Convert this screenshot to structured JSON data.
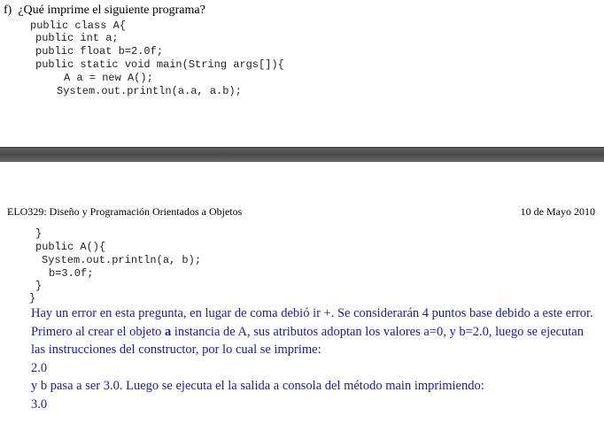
{
  "question": {
    "label": "f)",
    "text": "¿Qué imprime el siguiente programa?"
  },
  "code_top": [
    "public class A{",
    "public int a;",
    "public float b=2.0f;",
    "public static void main(String args[]){",
    "A a = new A();",
    "System.out.println(a.a, a.b);"
  ],
  "header": {
    "course": "ELO329: Diseño y Programación Orientados a Objetos",
    "date": "10 de Mayo 2010"
  },
  "code_bottom": [
    "}",
    "public A(){",
    "System.out.println(a, b);",
    "b=3.0f;",
    "}",
    "}"
  ],
  "answer": {
    "line1": "Hay un error en esta pregunta, en lugar de coma debió ir +. Se considerarán 4 puntos base debido a este error.",
    "line2_before": "Primero al crear el objeto ",
    "line2_bold": "a",
    "line2_after": " instancia de A, sus atributos adoptan los valores a=0, y b=2.0, luego se ejecutan las instrucciones del constructor, por lo cual se imprime:",
    "value1": "2.0",
    "line3": "y b pasa a ser 3.0. Luego se ejecuta el la salida a consola del método main imprimiendo:",
    "value2": "3.0"
  }
}
